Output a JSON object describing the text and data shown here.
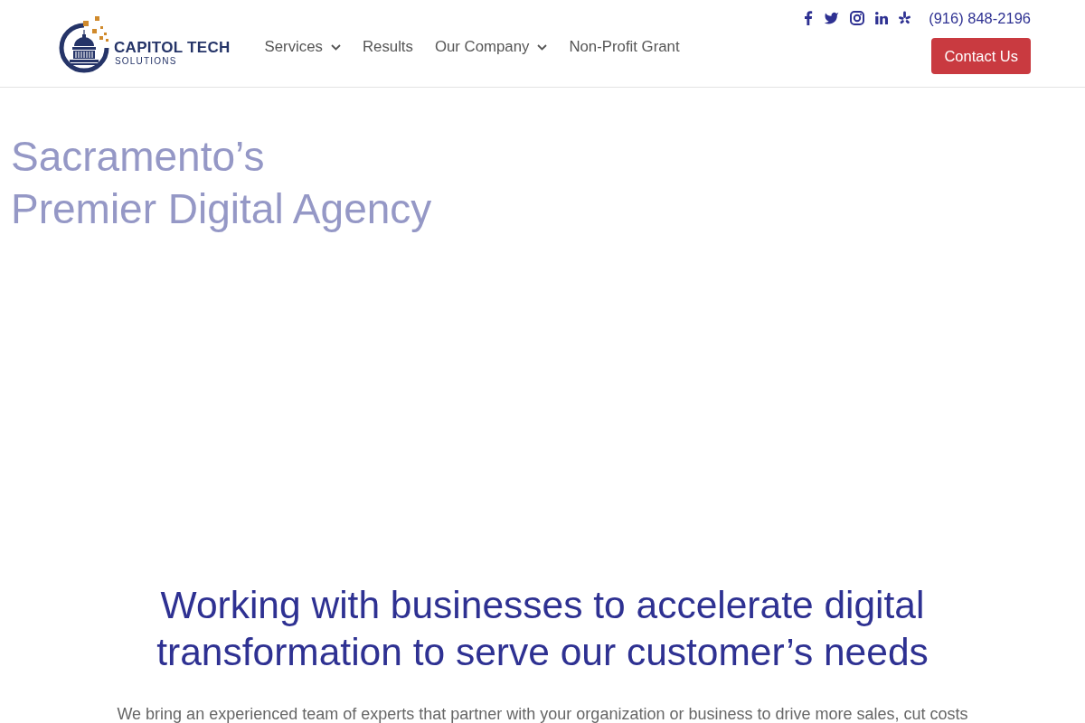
{
  "header": {
    "logo": {
      "name": "CAPITOL TECH",
      "tagline": "SOLUTIONS"
    },
    "nav": [
      {
        "label": "Services",
        "dropdown": true
      },
      {
        "label": "Results",
        "dropdown": false
      },
      {
        "label": "Our Company",
        "dropdown": true
      },
      {
        "label": "Non-Profit Grant",
        "dropdown": false
      }
    ],
    "phone": "(916) 848-2196",
    "contact_button": "Contact Us"
  },
  "hero": {
    "title_lines": [
      "Sacramento’s",
      "Premier Digital Agency"
    ]
  },
  "intro": {
    "heading_lines": [
      "Working with businesses to accelerate digital",
      "transformation to serve our customer’s needs"
    ],
    "text": "We bring an experienced team of experts that partner with your organization or business to drive more sales, cut costs"
  }
}
